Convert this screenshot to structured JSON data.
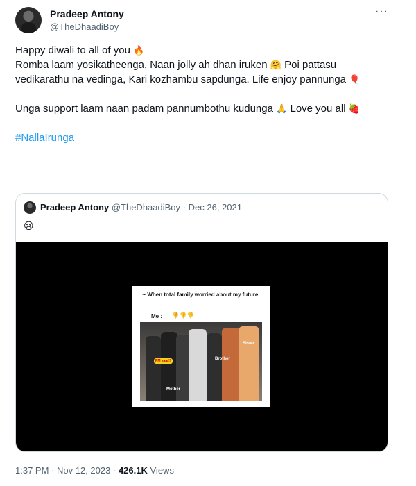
{
  "author": {
    "name": "Pradeep Antony",
    "handle": "@TheDhaadiBoy"
  },
  "more_icon": "···",
  "body": {
    "line1": "Happy diwali to all of you",
    "line1_emoji": "🔥",
    "line2_part1": "Romba laam yosikatheenga, Naan jolly ah dhan iruken",
    "line2_emoji1": "🤗",
    "line2_part2": "Poi pattasu vedikarathu na vedinga, Kari kozhambu sapdunga. Life enjoy pannunga",
    "line2_emoji2": "🎈",
    "line3": "Unga support laam naan padam pannumbothu kudunga",
    "line3_emoji1": "🙏",
    "line3_part2": "Love you all",
    "line3_emoji2": "🍓",
    "hashtag": "#NallaIrunga"
  },
  "quote": {
    "name": "Pradeep Antony",
    "handle": "@TheDhaadiBoy",
    "separator": "·",
    "date": "Dec 26, 2021",
    "emoji": "😢",
    "meme": {
      "caption": "~ When total family worried about my future.",
      "me_label": "Me :",
      "thumbs": "👎👎👎",
      "labels": {
        "pm_saar": "PM saar!!",
        "brother": "Brother",
        "sister": "Sister",
        "mother": "Mother"
      }
    }
  },
  "footer": {
    "time": "1:37 PM",
    "separator": "·",
    "date": "Nov 12, 2023",
    "views_count": "426.1K",
    "views_label": "Views"
  }
}
